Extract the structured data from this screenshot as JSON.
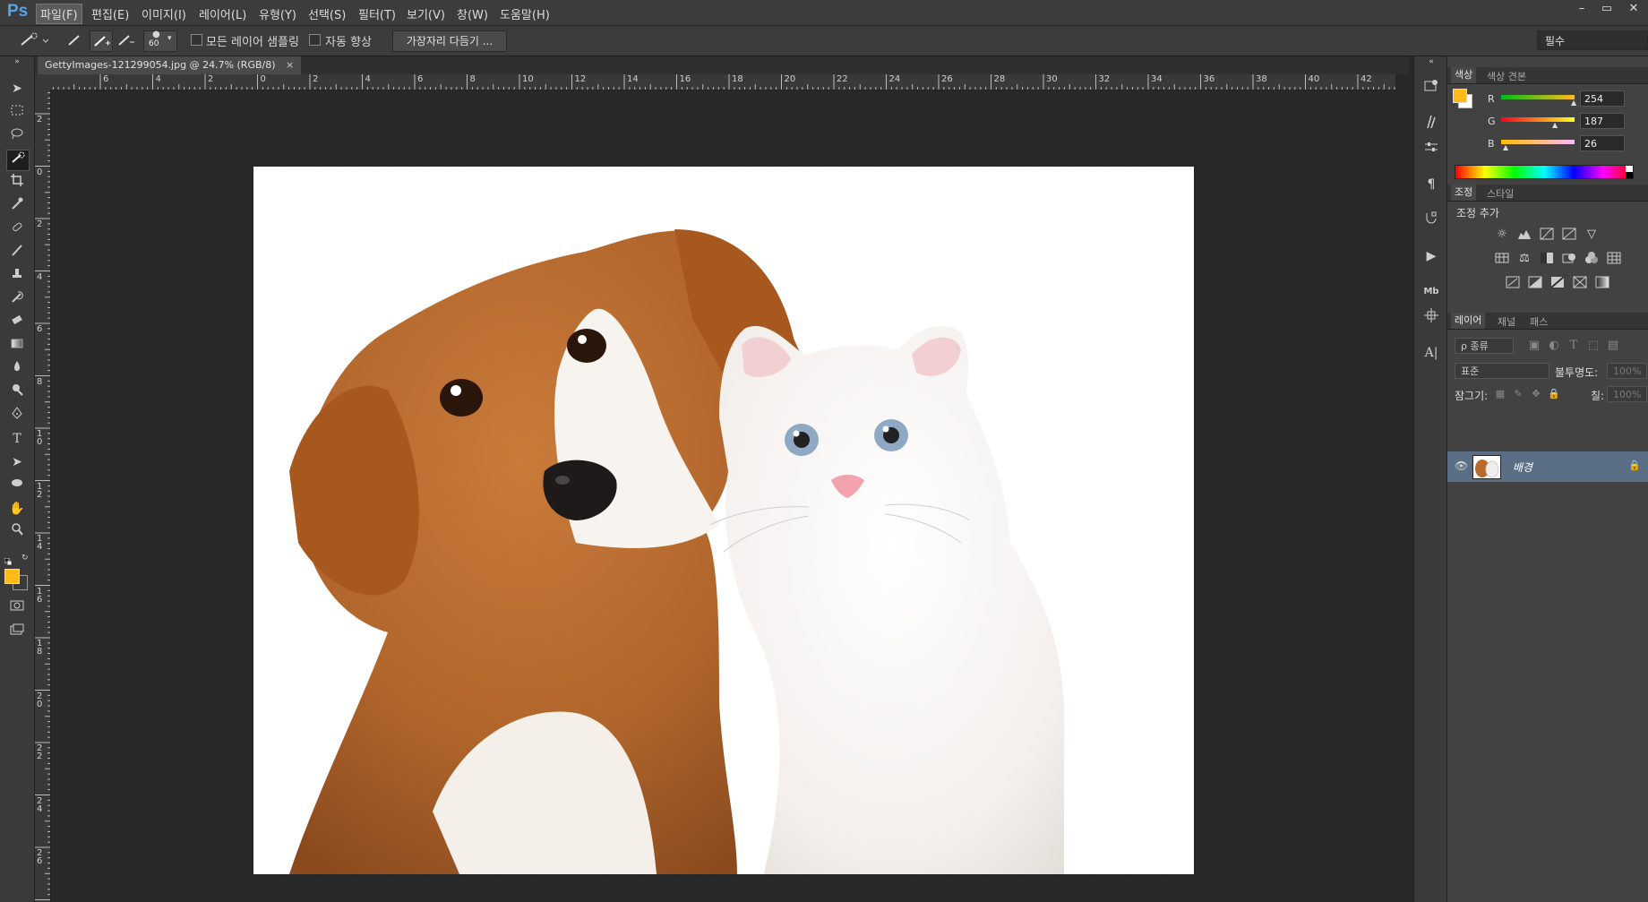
{
  "app": {
    "logo": "Ps"
  },
  "menu": [
    "파일(F)",
    "편집(E)",
    "이미지(I)",
    "레이어(L)",
    "유형(Y)",
    "선택(S)",
    "필터(T)",
    "보기(V)",
    "창(W)",
    "도움말(H)"
  ],
  "window_controls": [
    "–",
    "▭",
    "✕"
  ],
  "options": {
    "brush_size": "60",
    "sample_all_layers": "모든 레이어 샘플링",
    "auto_enhance": "자동 향상",
    "refine_edge": "가장자리 다듬기 ...",
    "workspace": "필수"
  },
  "document": {
    "tab_title": "GettyImages-121299054.jpg @ 24.7% (RGB/8)",
    "tab_close": "×",
    "h_ruler_labels": [
      "6",
      "4",
      "2",
      "0",
      "2",
      "4",
      "6",
      "8",
      "10",
      "12",
      "14",
      "16",
      "18",
      "20",
      "22",
      "24",
      "26",
      "28",
      "30",
      "32",
      "34",
      "36",
      "38",
      "40",
      "42"
    ],
    "v_ruler_labels": [
      "2",
      "0",
      "2",
      "4",
      "6",
      "8",
      "10",
      "12",
      "14",
      "16",
      "18",
      "20",
      "22",
      "24",
      "26"
    ]
  },
  "colors": {
    "foreground": "#FEBB1A",
    "background": "#FFFFFF",
    "dog_fur": "#B86A2E",
    "cat_fur": "#F4F1EE"
  },
  "color_panel": {
    "tabs": [
      "색상",
      "색상 견본"
    ],
    "r_label": "R",
    "g_label": "G",
    "b_label": "B",
    "r": "254",
    "g": "187",
    "b": "26"
  },
  "adjust_panel": {
    "tabs": [
      "조정",
      "스타일"
    ],
    "title": "조정 추가"
  },
  "layers_panel": {
    "tabs": [
      "레이어",
      "채널",
      "패스"
    ],
    "filter_kind": "ρ 종류",
    "blend_mode": "표준",
    "opacity_label": "불투명도:",
    "opacity_value": "100%",
    "lock_label": "잠그기:",
    "fill_label": "칠:",
    "fill_value": "100%",
    "layer_name": "배경"
  }
}
